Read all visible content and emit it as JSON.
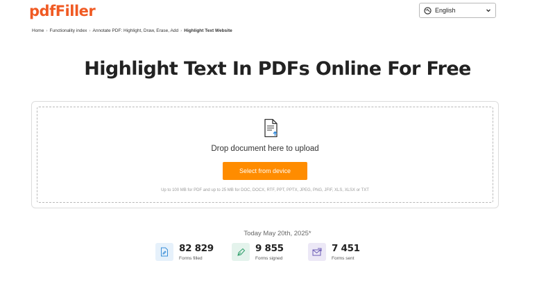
{
  "header": {
    "logo": "pdfFiller",
    "language": "English"
  },
  "breadcrumb": [
    "Home",
    "Functionality index",
    "Annotate PDF: Highlight, Draw, Erase, Add",
    "Highlight Text Website"
  ],
  "page_title": "Highlight Text In PDFs Online For Free",
  "upload": {
    "drop_text": "Drop document here to upload",
    "button_label": "Select from device",
    "limits_text": "Up to 100 MB for PDF and up to 25 MB for DOC, DOCX, RTF, PPT, PPTX, JPEG, PNG, JFIF, XLS, XLSX or TXT"
  },
  "stats": {
    "date_text": "Today May 20th, 2025*",
    "items": [
      {
        "value": "82 829",
        "label": "Forms filled",
        "icon": "file-edit-icon"
      },
      {
        "value": "9 855",
        "label": "Forms signed",
        "icon": "pen-nib-icon"
      },
      {
        "value": "7 451",
        "label": "Forms sent",
        "icon": "send-envelope-icon"
      }
    ]
  },
  "colors": {
    "brand": "#f05a23",
    "button": "#ff8c00",
    "upload_arrow": "#2b86d9"
  }
}
